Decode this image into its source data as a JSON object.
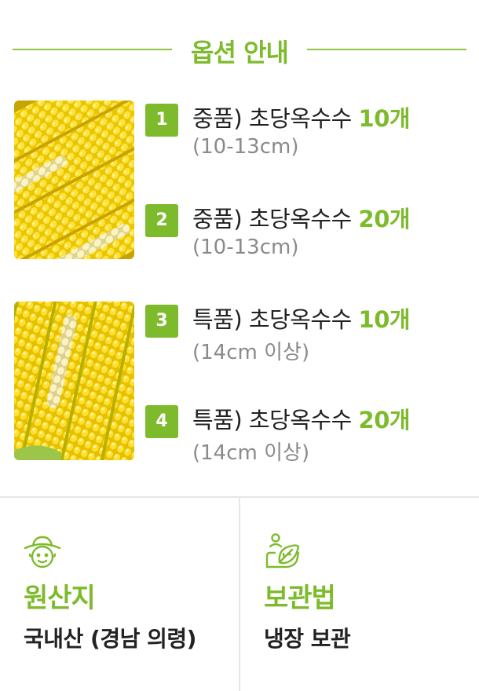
{
  "header": {
    "title": "옵션 안내"
  },
  "options": [
    {
      "number": "1",
      "name": "중품) 초당옥수수 ",
      "qty": "10개",
      "size": "(10-13cm)"
    },
    {
      "number": "2",
      "name": "중품) 초당옥수수 ",
      "qty": "20개",
      "size": "(10-13cm)"
    },
    {
      "number": "3",
      "name": "특품) 초당옥수수 ",
      "qty": "10개",
      "size": "(14cm 이상)"
    },
    {
      "number": "4",
      "name": "특품) 초당옥수수 ",
      "qty": "20개",
      "size": "(14cm 이상)"
    }
  ],
  "origin": {
    "icon": "farmer-icon",
    "label": "원산지",
    "value": "국내산 (경남 의령)"
  },
  "storage": {
    "icon": "leaf-hand-icon",
    "label": "보관법",
    "value": "냉장 보관"
  },
  "colors": {
    "accent": "#7dbb2c",
    "text": "#222222",
    "muted": "#8a8a8a"
  }
}
